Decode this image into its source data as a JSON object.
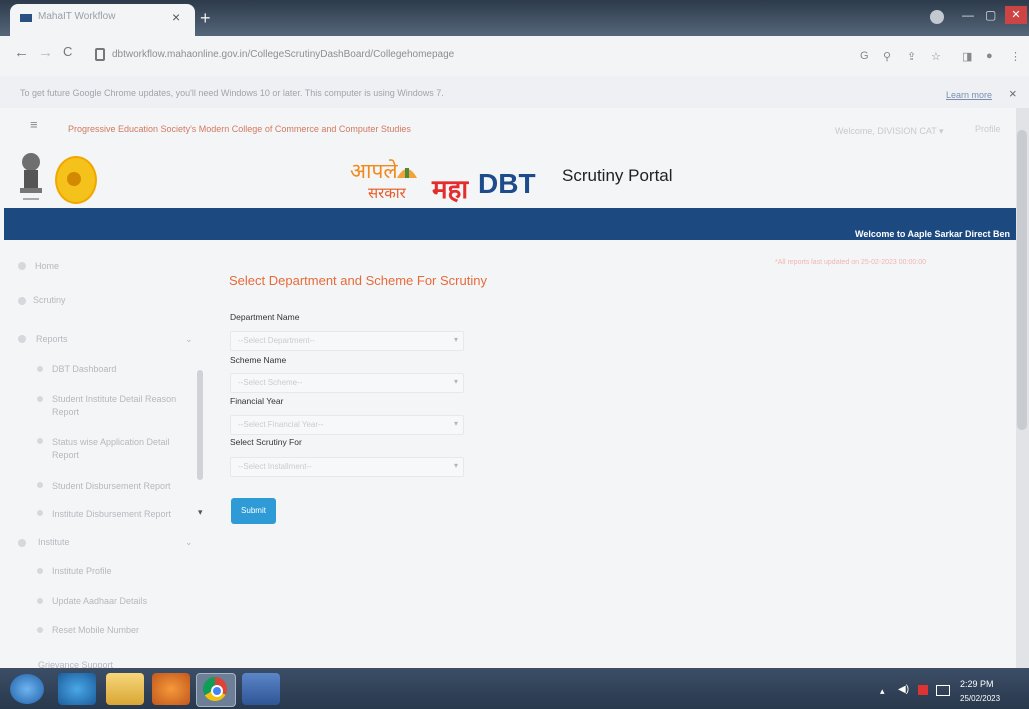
{
  "browser": {
    "tab_title": "MahaIT Workflow",
    "tab_close": "×",
    "new_tab": "+",
    "url": "dbtworkflow.mahaonline.gov.in/CollegeScrutinyDashBoard/Collegehomepage",
    "info_text": "To get future Google Chrome updates, you'll need Windows 10 or later. This computer is using Windows 7.",
    "learn_more": "Learn more",
    "info_close": "×",
    "back": "←",
    "forward": "→",
    "reload": "C"
  },
  "header": {
    "menu": "≡",
    "college_name": "Progressive Education Society's Modern College of Commerce and Computer Studies",
    "welcome_user": "Welcome, DIVISION CAT ▾",
    "logout": "Profile",
    "logo_aaple_1": "आपले",
    "logo_aaple_2": "सरकार",
    "logo_maha": "महा",
    "logo_dbt": "DBT",
    "portal_title": "Scrutiny Portal",
    "marquee": "Welcome to Aaple Sarkar Direct Ben"
  },
  "sidebar": {
    "items": [
      {
        "label": "Home"
      },
      {
        "label": "Scrutiny"
      },
      {
        "label": "Reports"
      },
      {
        "label": "DBT Dashboard"
      },
      {
        "label": "Student Institute Detail Reason Report"
      },
      {
        "label": "Status wise Application Detail Report"
      },
      {
        "label": "Student Disbursement Report"
      },
      {
        "label": "Institute Disbursement Report"
      },
      {
        "label": "Institute"
      },
      {
        "label": "Institute Profile"
      },
      {
        "label": "Update Aadhaar Details"
      },
      {
        "label": "Reset Mobile Number"
      },
      {
        "label": "Grievance Support"
      }
    ]
  },
  "form": {
    "title": "Select Department and Scheme For Scrutiny",
    "cache_note": "*All reports last updated on 25-02-2023 00:00:00",
    "department_label": "Department Name",
    "department_value": "--Select Department--",
    "scheme_label": "Scheme Name",
    "scheme_value": "--Select Scheme--",
    "year_label": "Financial Year",
    "year_value": "--Select Financial Year--",
    "installment_label": "Select Scrutiny For",
    "installment_value": "--Select Installment--",
    "submit": "Submit"
  },
  "taskbar": {
    "time": "2:29 PM",
    "date": "25/02/2023"
  },
  "colors": {
    "header_bar": "#1c4a80",
    "title_orange": "#e66b3b",
    "submit_blue": "#2e9bd6"
  }
}
